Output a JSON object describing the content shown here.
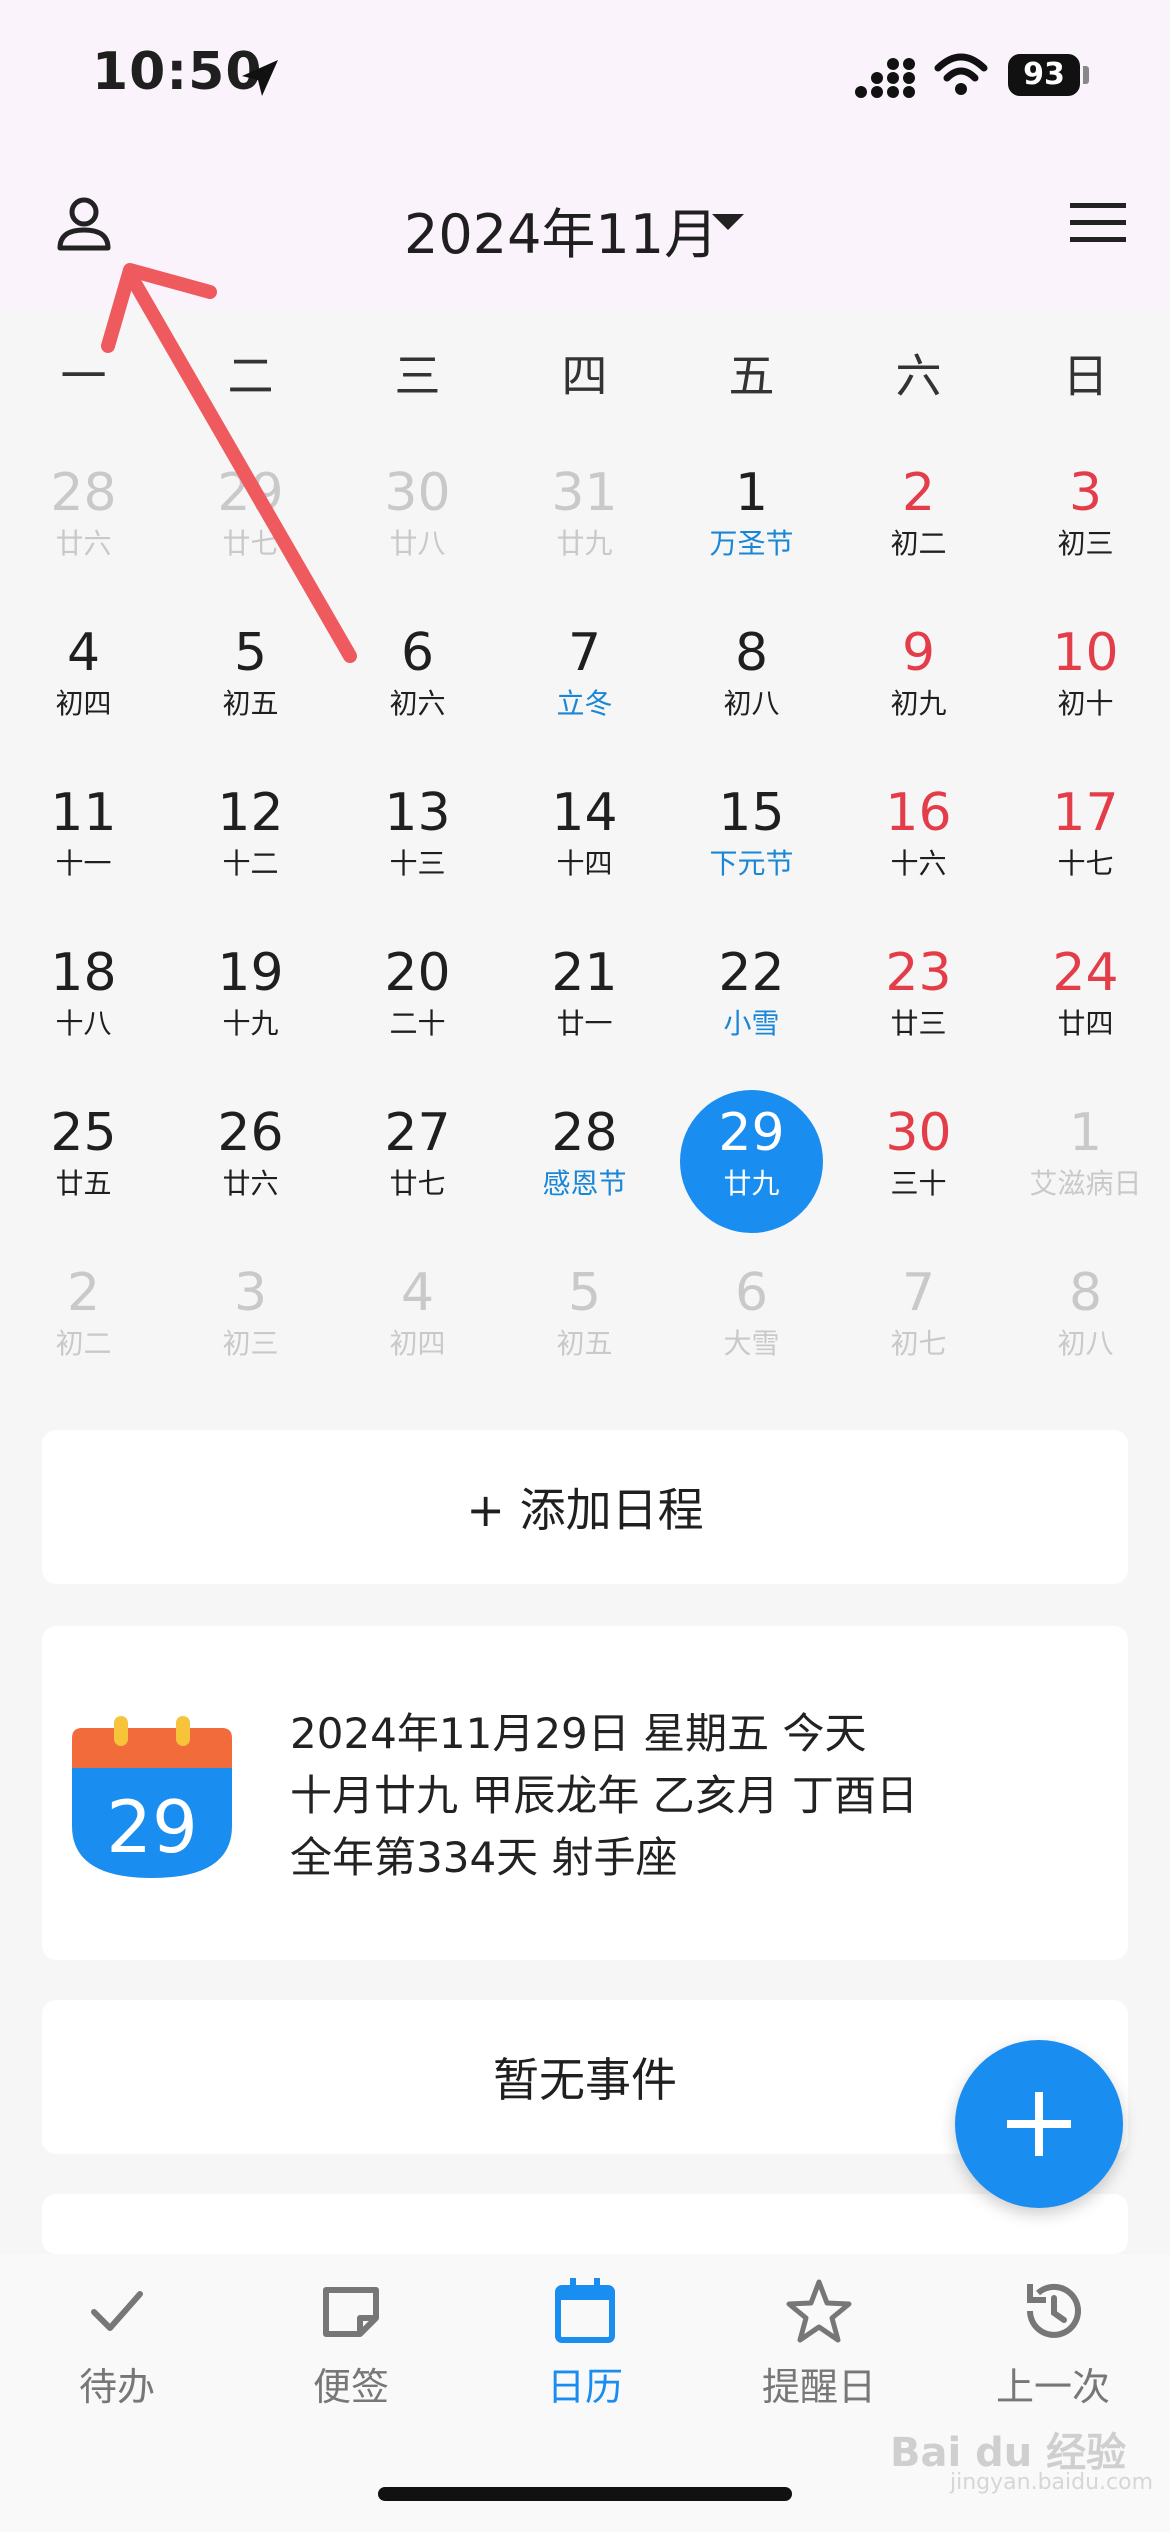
{
  "status": {
    "time": "10:50",
    "battery": "93"
  },
  "header": {
    "month_title": "2024年11月"
  },
  "weekdays": [
    "一",
    "二",
    "三",
    "四",
    "五",
    "六",
    "日"
  ],
  "calendar": [
    [
      {
        "n": "28",
        "s": "廿六",
        "t": "dim"
      },
      {
        "n": "29",
        "s": "廿七",
        "t": "dim"
      },
      {
        "n": "30",
        "s": "廿八",
        "t": "dim"
      },
      {
        "n": "31",
        "s": "廿九",
        "t": "dim"
      },
      {
        "n": "1",
        "s": "万圣节",
        "t": "holiday"
      },
      {
        "n": "2",
        "s": "初二",
        "t": "weekend"
      },
      {
        "n": "3",
        "s": "初三",
        "t": "weekend"
      }
    ],
    [
      {
        "n": "4",
        "s": "初四",
        "t": ""
      },
      {
        "n": "5",
        "s": "初五",
        "t": ""
      },
      {
        "n": "6",
        "s": "初六",
        "t": ""
      },
      {
        "n": "7",
        "s": "立冬",
        "t": "holiday"
      },
      {
        "n": "8",
        "s": "初八",
        "t": ""
      },
      {
        "n": "9",
        "s": "初九",
        "t": "weekend"
      },
      {
        "n": "10",
        "s": "初十",
        "t": "weekend"
      }
    ],
    [
      {
        "n": "11",
        "s": "十一",
        "t": ""
      },
      {
        "n": "12",
        "s": "十二",
        "t": ""
      },
      {
        "n": "13",
        "s": "十三",
        "t": ""
      },
      {
        "n": "14",
        "s": "十四",
        "t": ""
      },
      {
        "n": "15",
        "s": "下元节",
        "t": "holiday"
      },
      {
        "n": "16",
        "s": "十六",
        "t": "weekend"
      },
      {
        "n": "17",
        "s": "十七",
        "t": "weekend"
      }
    ],
    [
      {
        "n": "18",
        "s": "十八",
        "t": ""
      },
      {
        "n": "19",
        "s": "十九",
        "t": ""
      },
      {
        "n": "20",
        "s": "二十",
        "t": ""
      },
      {
        "n": "21",
        "s": "廿一",
        "t": ""
      },
      {
        "n": "22",
        "s": "小雪",
        "t": "holiday"
      },
      {
        "n": "23",
        "s": "廿三",
        "t": "weekend"
      },
      {
        "n": "24",
        "s": "廿四",
        "t": "weekend"
      }
    ],
    [
      {
        "n": "25",
        "s": "廿五",
        "t": ""
      },
      {
        "n": "26",
        "s": "廿六",
        "t": ""
      },
      {
        "n": "27",
        "s": "廿七",
        "t": ""
      },
      {
        "n": "28",
        "s": "感恩节",
        "t": "holiday"
      },
      {
        "n": "29",
        "s": "廿九",
        "t": "today"
      },
      {
        "n": "30",
        "s": "三十",
        "t": "weekend"
      },
      {
        "n": "1",
        "s": "艾滋病日",
        "t": "dim"
      }
    ],
    [
      {
        "n": "2",
        "s": "初二",
        "t": "dim"
      },
      {
        "n": "3",
        "s": "初三",
        "t": "dim"
      },
      {
        "n": "4",
        "s": "初四",
        "t": "dim"
      },
      {
        "n": "5",
        "s": "初五",
        "t": "dim"
      },
      {
        "n": "6",
        "s": "大雪",
        "t": "dim"
      },
      {
        "n": "7",
        "s": "初七",
        "t": "dim"
      },
      {
        "n": "8",
        "s": "初八",
        "t": "dim"
      }
    ]
  ],
  "add_schedule": "+ 添加日程",
  "today_info": {
    "icon_day": "29",
    "line1": "2024年11月29日 星期五 今天",
    "line2": "十月廿九 甲辰龙年 乙亥月 丁酉日",
    "line3": "全年第334天 射手座"
  },
  "no_events": "暂无事件",
  "tabs": [
    {
      "label": "待办",
      "icon": "check-icon"
    },
    {
      "label": "便签",
      "icon": "note-icon"
    },
    {
      "label": "日历",
      "icon": "calendar-icon"
    },
    {
      "label": "提醒日",
      "icon": "star-icon"
    },
    {
      "label": "上一次",
      "icon": "history-icon"
    }
  ],
  "watermark": {
    "brand": "Bai du 经验",
    "url": "jingyan.baidu.com"
  },
  "colors": {
    "accent": "#1a8df0",
    "weekend": "#e43d4a",
    "holiday": "#1a86d6",
    "annotation_arrow": "#ef5a5f"
  }
}
